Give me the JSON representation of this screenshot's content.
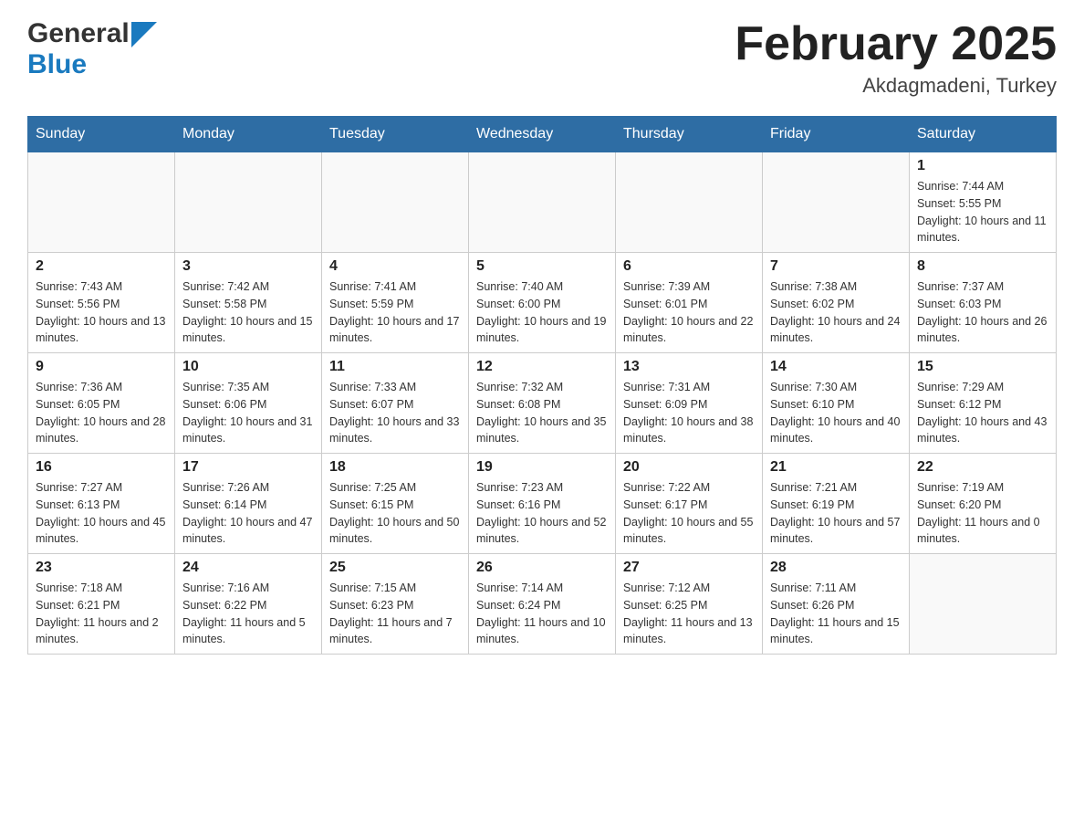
{
  "header": {
    "logo_general": "General",
    "logo_blue": "Blue",
    "month": "February 2025",
    "location": "Akdagmadeni, Turkey"
  },
  "days_of_week": [
    "Sunday",
    "Monday",
    "Tuesday",
    "Wednesday",
    "Thursday",
    "Friday",
    "Saturday"
  ],
  "weeks": [
    [
      {
        "day": "",
        "sunrise": "",
        "sunset": "",
        "daylight": ""
      },
      {
        "day": "",
        "sunrise": "",
        "sunset": "",
        "daylight": ""
      },
      {
        "day": "",
        "sunrise": "",
        "sunset": "",
        "daylight": ""
      },
      {
        "day": "",
        "sunrise": "",
        "sunset": "",
        "daylight": ""
      },
      {
        "day": "",
        "sunrise": "",
        "sunset": "",
        "daylight": ""
      },
      {
        "day": "",
        "sunrise": "",
        "sunset": "",
        "daylight": ""
      },
      {
        "day": "1",
        "sunrise": "Sunrise: 7:44 AM",
        "sunset": "Sunset: 5:55 PM",
        "daylight": "Daylight: 10 hours and 11 minutes."
      }
    ],
    [
      {
        "day": "2",
        "sunrise": "Sunrise: 7:43 AM",
        "sunset": "Sunset: 5:56 PM",
        "daylight": "Daylight: 10 hours and 13 minutes."
      },
      {
        "day": "3",
        "sunrise": "Sunrise: 7:42 AM",
        "sunset": "Sunset: 5:58 PM",
        "daylight": "Daylight: 10 hours and 15 minutes."
      },
      {
        "day": "4",
        "sunrise": "Sunrise: 7:41 AM",
        "sunset": "Sunset: 5:59 PM",
        "daylight": "Daylight: 10 hours and 17 minutes."
      },
      {
        "day": "5",
        "sunrise": "Sunrise: 7:40 AM",
        "sunset": "Sunset: 6:00 PM",
        "daylight": "Daylight: 10 hours and 19 minutes."
      },
      {
        "day": "6",
        "sunrise": "Sunrise: 7:39 AM",
        "sunset": "Sunset: 6:01 PM",
        "daylight": "Daylight: 10 hours and 22 minutes."
      },
      {
        "day": "7",
        "sunrise": "Sunrise: 7:38 AM",
        "sunset": "Sunset: 6:02 PM",
        "daylight": "Daylight: 10 hours and 24 minutes."
      },
      {
        "day": "8",
        "sunrise": "Sunrise: 7:37 AM",
        "sunset": "Sunset: 6:03 PM",
        "daylight": "Daylight: 10 hours and 26 minutes."
      }
    ],
    [
      {
        "day": "9",
        "sunrise": "Sunrise: 7:36 AM",
        "sunset": "Sunset: 6:05 PM",
        "daylight": "Daylight: 10 hours and 28 minutes."
      },
      {
        "day": "10",
        "sunrise": "Sunrise: 7:35 AM",
        "sunset": "Sunset: 6:06 PM",
        "daylight": "Daylight: 10 hours and 31 minutes."
      },
      {
        "day": "11",
        "sunrise": "Sunrise: 7:33 AM",
        "sunset": "Sunset: 6:07 PM",
        "daylight": "Daylight: 10 hours and 33 minutes."
      },
      {
        "day": "12",
        "sunrise": "Sunrise: 7:32 AM",
        "sunset": "Sunset: 6:08 PM",
        "daylight": "Daylight: 10 hours and 35 minutes."
      },
      {
        "day": "13",
        "sunrise": "Sunrise: 7:31 AM",
        "sunset": "Sunset: 6:09 PM",
        "daylight": "Daylight: 10 hours and 38 minutes."
      },
      {
        "day": "14",
        "sunrise": "Sunrise: 7:30 AM",
        "sunset": "Sunset: 6:10 PM",
        "daylight": "Daylight: 10 hours and 40 minutes."
      },
      {
        "day": "15",
        "sunrise": "Sunrise: 7:29 AM",
        "sunset": "Sunset: 6:12 PM",
        "daylight": "Daylight: 10 hours and 43 minutes."
      }
    ],
    [
      {
        "day": "16",
        "sunrise": "Sunrise: 7:27 AM",
        "sunset": "Sunset: 6:13 PM",
        "daylight": "Daylight: 10 hours and 45 minutes."
      },
      {
        "day": "17",
        "sunrise": "Sunrise: 7:26 AM",
        "sunset": "Sunset: 6:14 PM",
        "daylight": "Daylight: 10 hours and 47 minutes."
      },
      {
        "day": "18",
        "sunrise": "Sunrise: 7:25 AM",
        "sunset": "Sunset: 6:15 PM",
        "daylight": "Daylight: 10 hours and 50 minutes."
      },
      {
        "day": "19",
        "sunrise": "Sunrise: 7:23 AM",
        "sunset": "Sunset: 6:16 PM",
        "daylight": "Daylight: 10 hours and 52 minutes."
      },
      {
        "day": "20",
        "sunrise": "Sunrise: 7:22 AM",
        "sunset": "Sunset: 6:17 PM",
        "daylight": "Daylight: 10 hours and 55 minutes."
      },
      {
        "day": "21",
        "sunrise": "Sunrise: 7:21 AM",
        "sunset": "Sunset: 6:19 PM",
        "daylight": "Daylight: 10 hours and 57 minutes."
      },
      {
        "day": "22",
        "sunrise": "Sunrise: 7:19 AM",
        "sunset": "Sunset: 6:20 PM",
        "daylight": "Daylight: 11 hours and 0 minutes."
      }
    ],
    [
      {
        "day": "23",
        "sunrise": "Sunrise: 7:18 AM",
        "sunset": "Sunset: 6:21 PM",
        "daylight": "Daylight: 11 hours and 2 minutes."
      },
      {
        "day": "24",
        "sunrise": "Sunrise: 7:16 AM",
        "sunset": "Sunset: 6:22 PM",
        "daylight": "Daylight: 11 hours and 5 minutes."
      },
      {
        "day": "25",
        "sunrise": "Sunrise: 7:15 AM",
        "sunset": "Sunset: 6:23 PM",
        "daylight": "Daylight: 11 hours and 7 minutes."
      },
      {
        "day": "26",
        "sunrise": "Sunrise: 7:14 AM",
        "sunset": "Sunset: 6:24 PM",
        "daylight": "Daylight: 11 hours and 10 minutes."
      },
      {
        "day": "27",
        "sunrise": "Sunrise: 7:12 AM",
        "sunset": "Sunset: 6:25 PM",
        "daylight": "Daylight: 11 hours and 13 minutes."
      },
      {
        "day": "28",
        "sunrise": "Sunrise: 7:11 AM",
        "sunset": "Sunset: 6:26 PM",
        "daylight": "Daylight: 11 hours and 15 minutes."
      },
      {
        "day": "",
        "sunrise": "",
        "sunset": "",
        "daylight": ""
      }
    ]
  ]
}
